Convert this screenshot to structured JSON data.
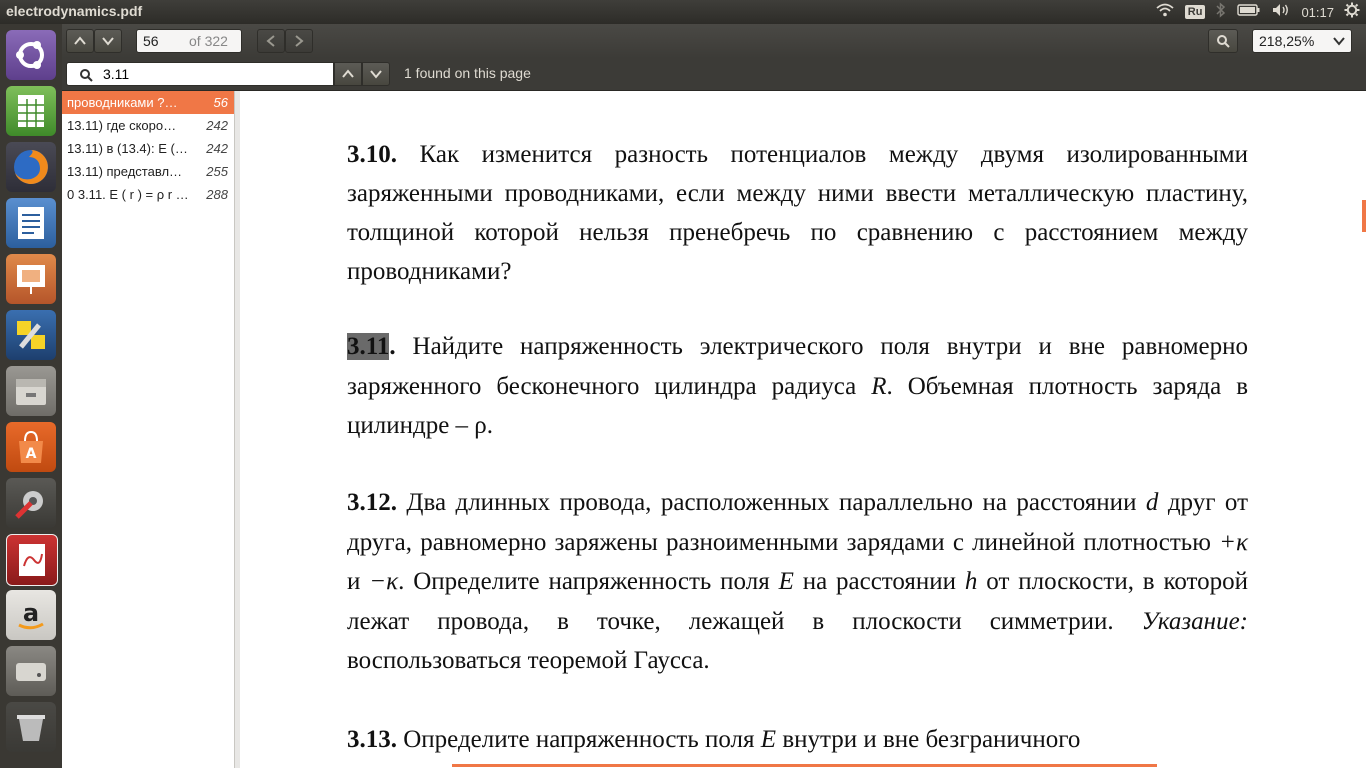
{
  "window": {
    "title": "electrodynamics.pdf"
  },
  "tray": {
    "keyboard": "Ru",
    "time": "01:17"
  },
  "toolbar": {
    "page_current": "56",
    "page_total": "of 322",
    "zoom": "218,25%"
  },
  "find": {
    "query": "3.11",
    "status": "1 found on this page"
  },
  "results": [
    {
      "text": "проводниками ?…",
      "page": "56"
    },
    {
      "text": "13.11) где скоро…",
      "page": "242"
    },
    {
      "text": "13.11) в (13.4): E (…",
      "page": "242"
    },
    {
      "text": "13.11) представл…",
      "page": "255"
    },
    {
      "text": "0 3.11. E ( r ) = ρ r …",
      "page": "288"
    }
  ],
  "document": {
    "p1_num": "3.10.",
    "p1_text": " Как изменится разность потенциалов между двумя изолированными заряженными проводниками, если между ними ввести металлическую пластину, толщиной которой  нельзя пренебречь по сравнению с расстоянием между проводниками?",
    "p2_num": "3.11",
    "p2_dot": ".",
    "p2_text": " Найдите напряженность электрического поля внутри и вне равномерно заряженного бесконечного цилиндра радиуса ",
    "p2_var": "R",
    "p2_text2": ". Объемная плотность заряда в цилиндре – ρ.",
    "p3_num": "3.12.",
    "p3_text": " Два длинных провода, расположенных параллельно на расстоянии ",
    "p3_d": "d",
    "p3_text2": " друг от друга, равномерно заряжены разноименными зарядами с линейной плотностью ",
    "p3_k1": "+κ",
    "p3_and": " и ",
    "p3_k2": "−κ",
    "p3_text3": ". Определите напряженность поля ",
    "p3_E": "E",
    "p3_text4": " на расстоянии ",
    "p3_h": "h",
    "p3_text5": " от плоскости, в которой лежат провода, в точке, лежащей в плоскости симметрии. ",
    "p3_hint": "Указание:",
    "p3_text6": " воспользоваться теоремой Гаусса.",
    "p4_num": "3.13.",
    "p4_text": " Определите напряженность поля ",
    "p4_E": "E",
    "p4_text2": " внутри и вне безграничного"
  },
  "colors": {
    "accent": "#f07746",
    "panel": "#3c3b37",
    "launcher": "#3a3833"
  },
  "launcher_icons": [
    "ubuntu-dash-icon",
    "libreoffice-calc-icon",
    "firefox-icon",
    "libreoffice-writer-icon",
    "libreoffice-impress-icon",
    "system-settings-icon",
    "files-icon",
    "software-center-icon",
    "tools-icon",
    "document-viewer-icon",
    "amazon-icon",
    "drive-icon",
    "trash-icon"
  ]
}
